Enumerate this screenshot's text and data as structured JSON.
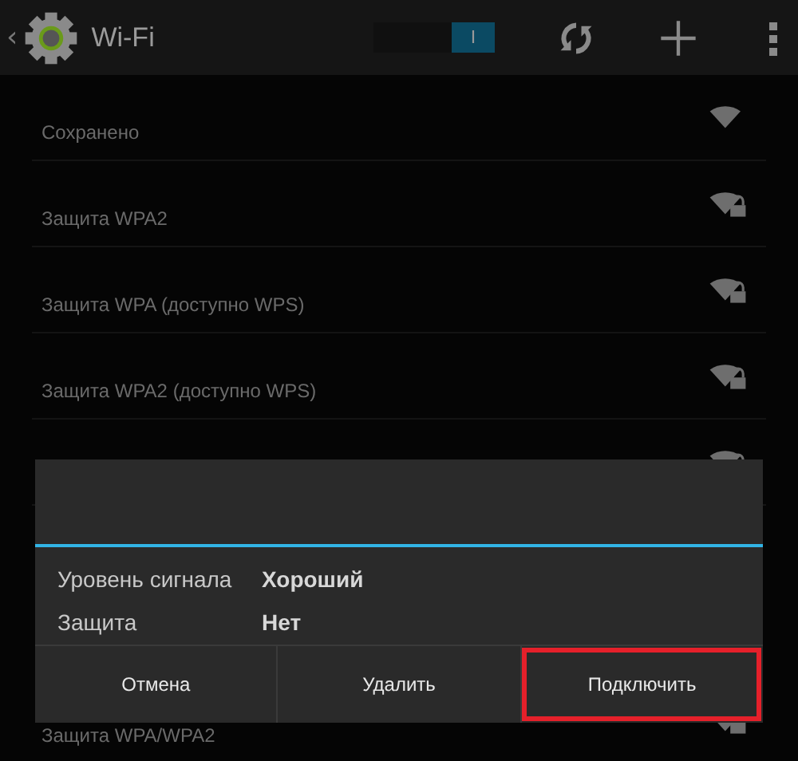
{
  "action_bar": {
    "back": "‹",
    "title": "Wi-Fi",
    "wifi_switch": {
      "on": true,
      "label": "I"
    }
  },
  "networks": [
    {
      "subtitle": "Сохранено",
      "secured": false
    },
    {
      "subtitle": "Защита WPA2",
      "secured": true
    },
    {
      "subtitle": "Защита WPA (доступно WPS)",
      "secured": true
    },
    {
      "subtitle": "Защита WPA2 (доступно WPS)",
      "secured": true
    },
    {
      "secured": true
    },
    {
      "subtitle": "Защита WPA/WPA2",
      "secured": true
    }
  ],
  "dialog": {
    "details": [
      {
        "label": "Уровень сигнала",
        "value": "Хороший"
      },
      {
        "label": "Защита",
        "value": "Нет"
      }
    ],
    "buttons": [
      {
        "label": "Отмена",
        "highlighted": false
      },
      {
        "label": "Удалить",
        "highlighted": false
      },
      {
        "label": "Подключить",
        "highlighted": true
      }
    ]
  }
}
